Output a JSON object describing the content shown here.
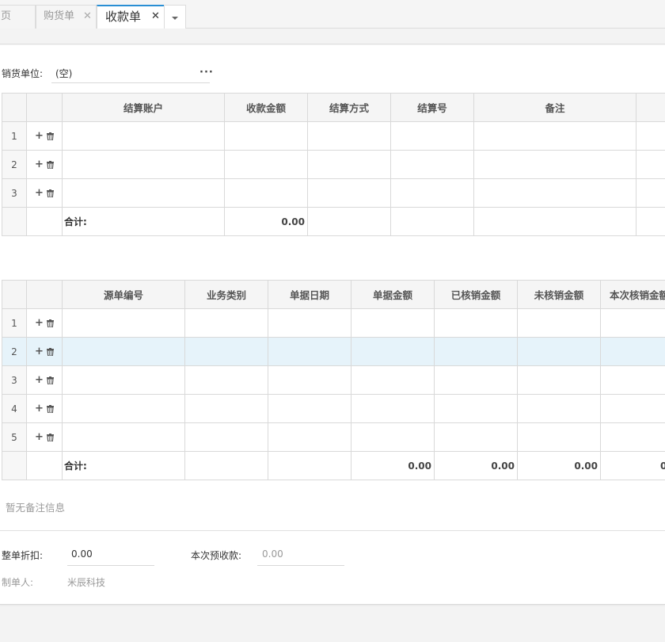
{
  "tabs": [
    {
      "label": "页",
      "closable": false,
      "active": false
    },
    {
      "label": "购货单",
      "closable": true,
      "active": false
    },
    {
      "label": "收款单",
      "closable": true,
      "active": true
    }
  ],
  "icons": {
    "close": "close-icon",
    "more": "caret-down-icon",
    "add": "plus-icon",
    "delete": "trash-icon",
    "lookup": "ellipsis-icon"
  },
  "colors": {
    "accent": "#2a8fd4",
    "highlight_row": "#e6f3fa"
  },
  "form": {
    "customer_label": "销货单位:",
    "customer_value": "(空)",
    "lookup_label": "···"
  },
  "settlement_table": {
    "headers": [
      "结算账户",
      "收款金额",
      "结算方式",
      "结算号",
      "备注"
    ],
    "rows": [
      "1",
      "2",
      "3"
    ],
    "total_label": "合计:",
    "total_amount": "0.00"
  },
  "source_table": {
    "headers": [
      "源单编号",
      "业务类别",
      "单据日期",
      "单据金额",
      "已核销金额",
      "未核销金额",
      "本次核销金额"
    ],
    "rows": [
      "1",
      "2",
      "3",
      "4",
      "5"
    ],
    "total_label": "合计:",
    "totals": [
      "0.00",
      "0.00",
      "0.00",
      "0"
    ]
  },
  "note_text": "暂无备注信息",
  "footer": {
    "discount_label": "整单折扣:",
    "discount_value": "0.00",
    "prepay_label": "本次预收款:",
    "prepay_value": "0.00",
    "maker_label": "制单人:",
    "maker_value": "米辰科技"
  }
}
